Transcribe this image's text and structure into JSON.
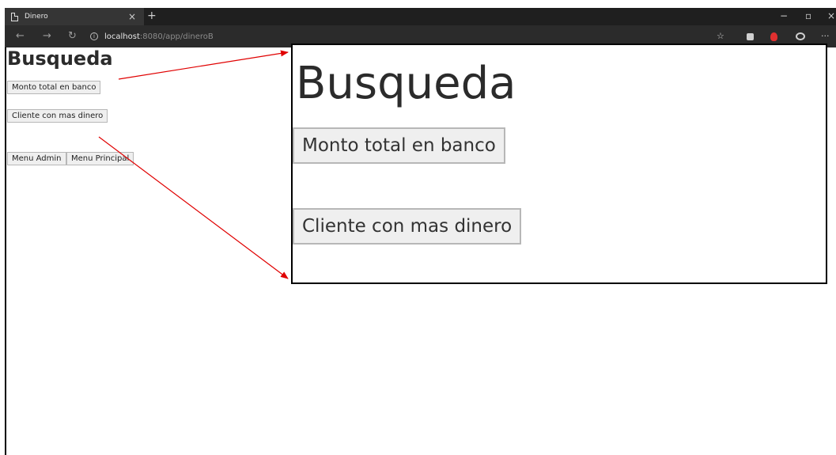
{
  "browser": {
    "tab_title": "Dinero",
    "tab_close": "×",
    "new_tab": "+",
    "window_controls": {
      "minimize": "−",
      "maximize": "▫",
      "close": "×"
    },
    "nav": {
      "back": "←",
      "forward": "→",
      "reload": "↻"
    },
    "info_icon_glyph": "i",
    "url_host": "localhost",
    "url_path": ":8080/app/dineroB",
    "toolbar_icons": {
      "star": "☆",
      "more": "···"
    }
  },
  "page": {
    "title": "Busqueda",
    "buttons": {
      "monto_total": "Monto total en banco",
      "cliente_mas_dinero": "Cliente con mas dinero",
      "menu_admin": "Menu Admin",
      "menu_principal": "Menu Principal"
    }
  },
  "zoom_callout": {
    "title": "Busqueda",
    "monto_total": "Monto total en banco",
    "cliente_mas_dinero": "Cliente con mas dinero"
  },
  "colors": {
    "arrow": "#e00000",
    "chrome_dark": "#1f1f1f"
  }
}
